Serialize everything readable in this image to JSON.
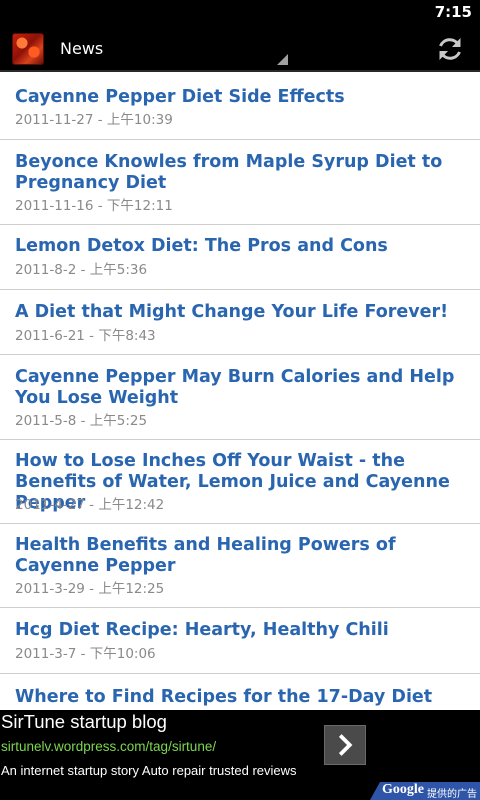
{
  "status_bar": {
    "time": "7:15"
  },
  "action_bar": {
    "title": "News",
    "app_icon": "cayenne-pepper-icon",
    "refresh_icon": "refresh-icon"
  },
  "articles": [
    {
      "title": "Cayenne Pepper Diet Side Effects",
      "date": "2011-11-27 - 上午10:39"
    },
    {
      "title": "Beyonce Knowles from Maple Syrup Diet to Pregnancy Diet",
      "date": "2011-11-16 - 下午12:11"
    },
    {
      "title": "Lemon Detox Diet: The Pros and Cons",
      "date": "2011-8-2 - 上午5:36"
    },
    {
      "title": "A Diet that Might Change Your Life Forever!",
      "date": "2011-6-21 - 下午8:43"
    },
    {
      "title": "Cayenne Pepper May Burn Calories and Help You Lose Weight",
      "date": "2011-5-8 - 上午5:25"
    },
    {
      "title": "How to Lose Inches Off Your Waist - the Benefits of Water, Lemon Juice and Cayenne Pepper",
      "date": "2011-4-27 - 上午12:42"
    },
    {
      "title": "Health Benefits and Healing Powers of Cayenne Pepper",
      "date": "2011-3-29 - 上午12:25"
    },
    {
      "title": "Hcg Diet Recipe: Hearty, Healthy Chili",
      "date": "2011-3-7 - 下午10:06"
    },
    {
      "title": "Where to Find Recipes for the 17-Day Diet",
      "date": ""
    }
  ],
  "ad": {
    "title": "SirTune startup blog",
    "url": "sirtunelv.wordpress.com/tag/sirtune/",
    "description": "An internet startup story Auto repair trusted reviews",
    "go_icon": "chevron-right-icon",
    "brand": "Google",
    "provided_by": "提供的广告"
  },
  "colors": {
    "title_link": "#2a66b0",
    "date_text": "#8a8a8a",
    "ad_url": "#7bd84e",
    "ad_footer": "#2f55a8"
  }
}
